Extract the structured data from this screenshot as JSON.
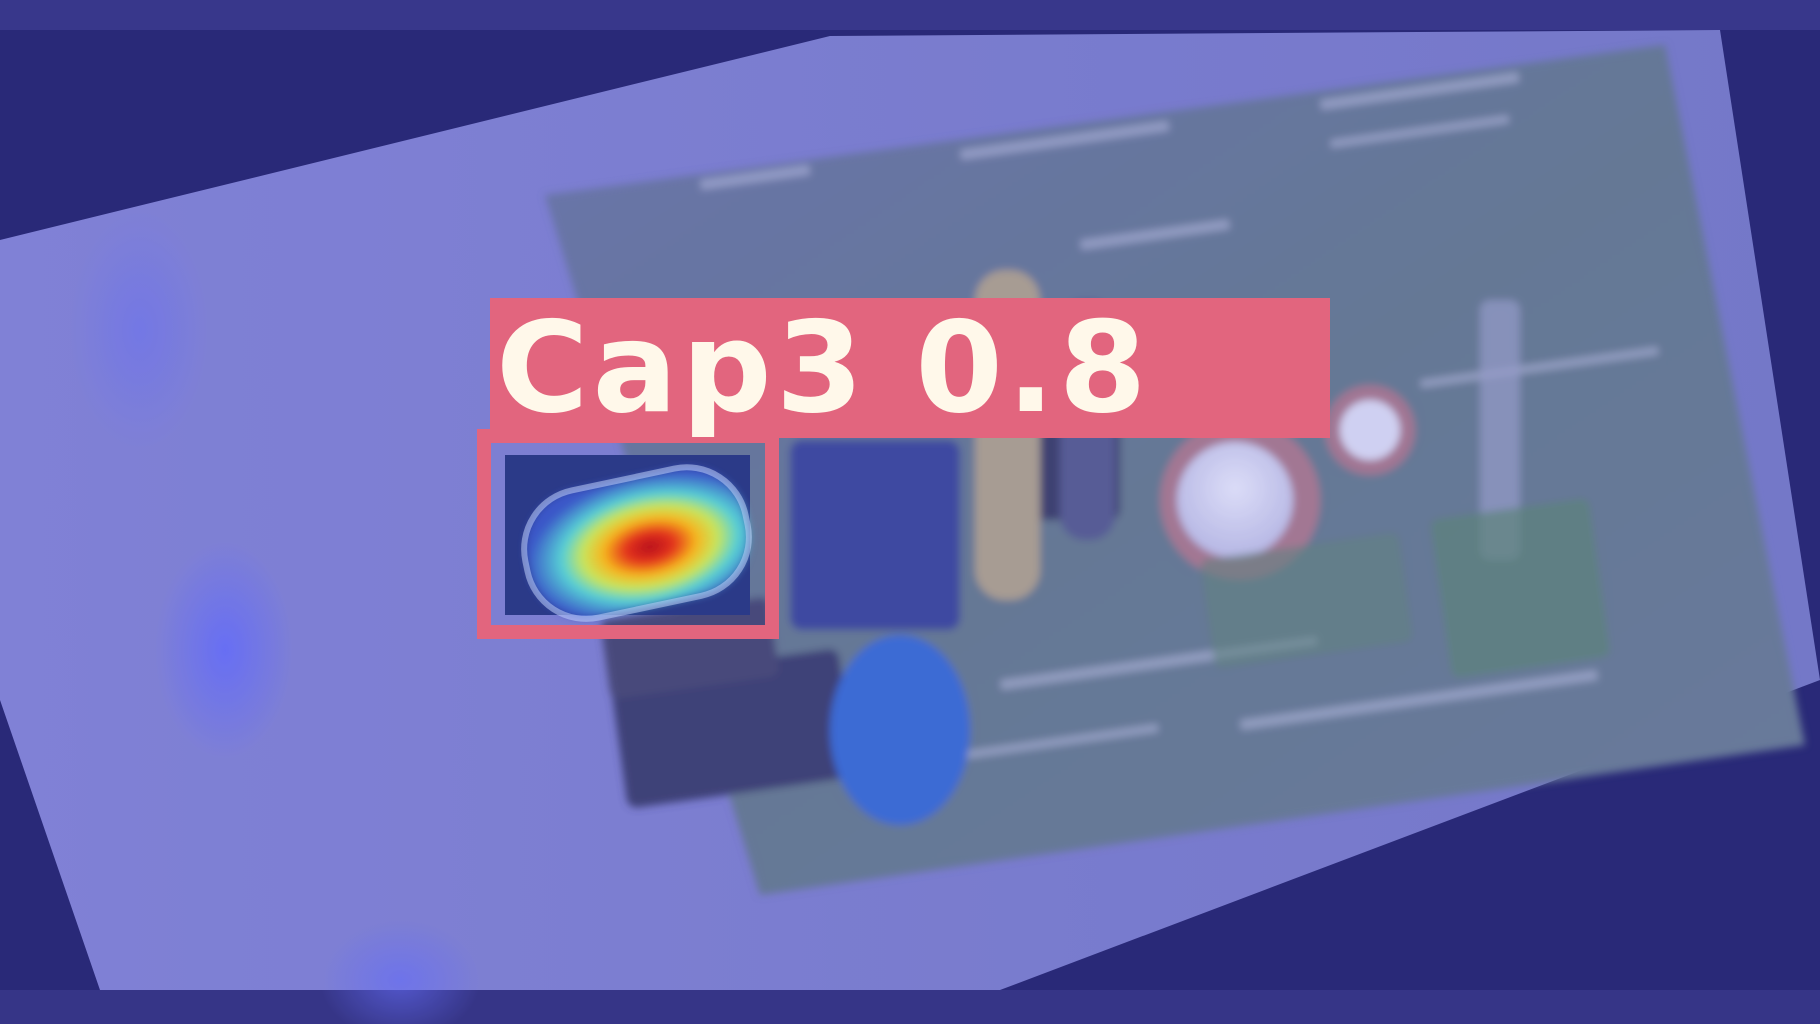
{
  "detection": {
    "label": "Cap3 0.8",
    "box_color": "#e2657e",
    "label_text_color": "#fff8ea"
  },
  "palette": {
    "background": "#25246a",
    "heatmap_overlay_tint": "#5a5fd0"
  }
}
